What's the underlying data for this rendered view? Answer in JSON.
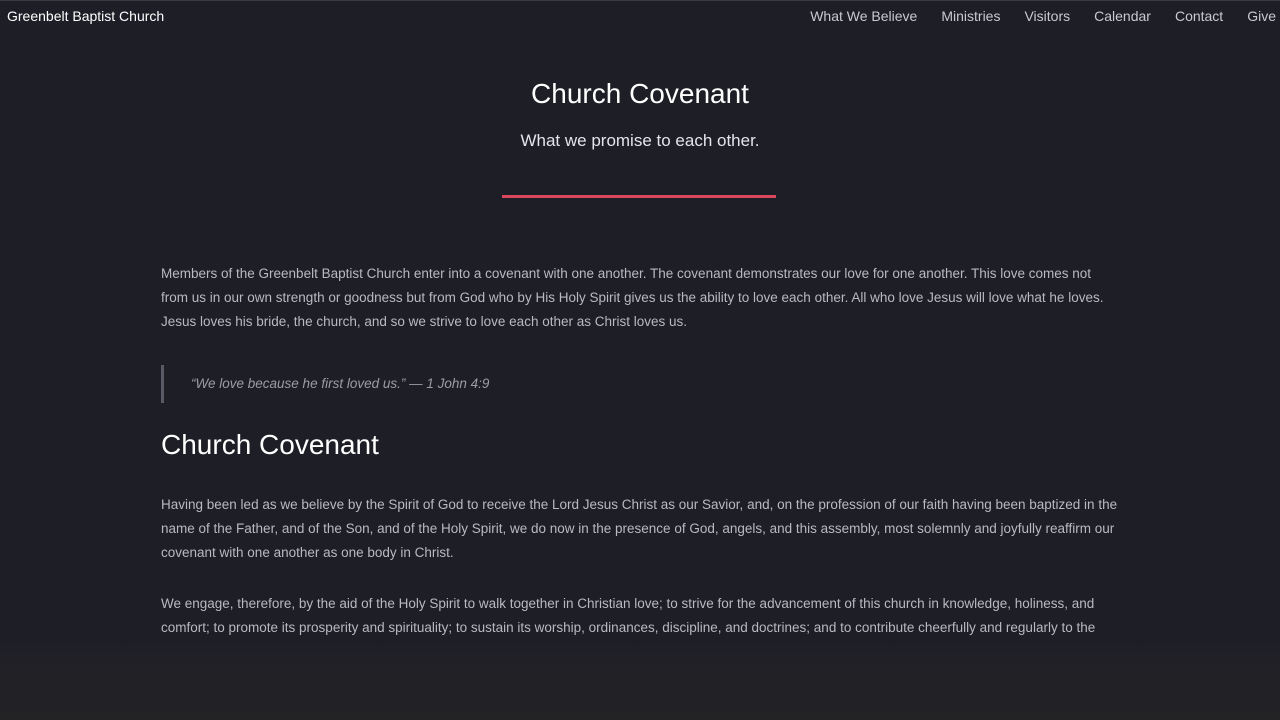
{
  "nav": {
    "brand": "Greenbelt Baptist Church",
    "links": [
      "What We Believe",
      "Ministries",
      "Visitors",
      "Calendar",
      "Contact",
      "Give"
    ]
  },
  "hero": {
    "title": "Church Covenant",
    "subtitle": "What we promise to each other.",
    "accent_color": "#d9485c"
  },
  "content": {
    "intro": "Members of the Greenbelt Baptist Church enter into a covenant with one another. The covenant demonstrates our love for one another. This love comes not from us in our own strength or goodness but from God who by His Holy Spirit gives us the ability to love each other. All who love Jesus will love what he loves. Jesus loves his bride, the church, and so we strive to love each other as Christ loves us.",
    "quote": "“We love because he first loved us.” — 1 John 4:9",
    "section_title": "Church Covenant",
    "paragraph_1": "Having been led as we believe by the Spirit of God to receive the Lord Jesus Christ as our Savior, and, on the profession of our faith having been baptized in the name of the Father, and of the Son, and of the Holy Spirit, we do now in the presence of God, angels, and this assembly, most solemnly and joyfully reaffirm our covenant with one another as one body in Christ.",
    "paragraph_2": "We engage, therefore, by the aid of the Holy Spirit to walk together in Christian love; to strive for the advancement of this church in knowledge, holiness, and comfort; to promote its prosperity and spirituality; to sustain its worship, ordinances, discipline, and doctrines; and to contribute cheerfully and regularly to the"
  }
}
